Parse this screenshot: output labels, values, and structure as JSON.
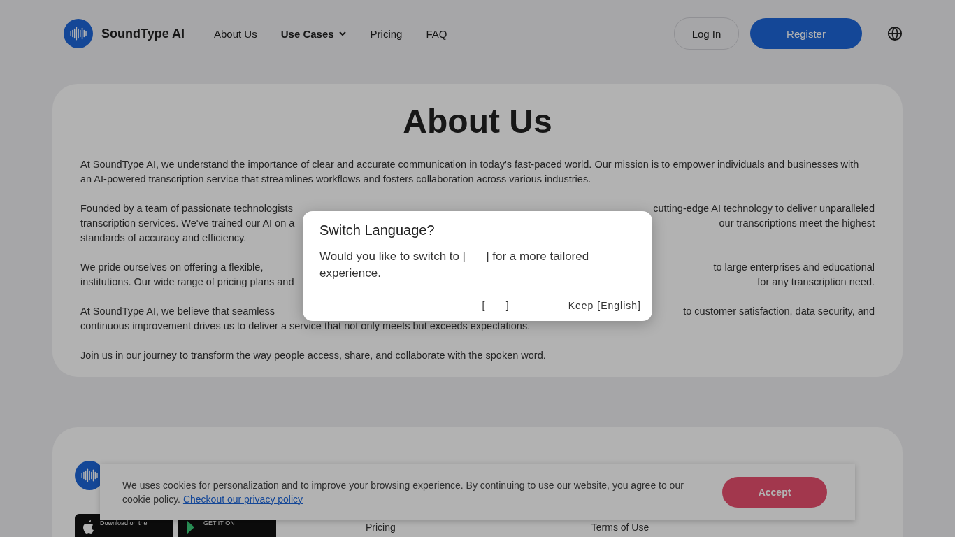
{
  "header": {
    "brand": "SoundType AI",
    "nav": [
      {
        "label": "About Us",
        "dropdown": false
      },
      {
        "label": "Use Cases",
        "dropdown": true
      },
      {
        "label": "Pricing",
        "dropdown": false
      },
      {
        "label": "FAQ",
        "dropdown": false
      }
    ],
    "login": "Log In",
    "register": "Register"
  },
  "about": {
    "title": "About Us",
    "paragraphs": [
      {
        "lines": [
          [
            "At SoundType AI, we understand the importance of clear and accurate communication in today's fast-paced world. Our mission is to empower individuals and businesses with"
          ],
          [
            "an AI-powered transcription service that streamlines workflows and fosters collaboration across various industries."
          ]
        ]
      },
      {
        "lines": [
          [
            "Founded by a team of passionate technologists",
            "cutting-edge AI technology to deliver unparalleled"
          ],
          [
            "transcription services. We've trained our AI on a",
            "our transcriptions meet the highest"
          ],
          [
            "standards of accuracy and efficiency."
          ]
        ]
      },
      {
        "lines": [
          [
            "We pride ourselves on offering a flexible,",
            "to large enterprises and educational"
          ],
          [
            "institutions. Our wide range of pricing plans and",
            "for any transcription need."
          ]
        ]
      },
      {
        "lines": [
          [
            "At SoundType AI, we believe that seamless",
            "to customer satisfaction, data security, and"
          ],
          [
            "continuous improvement drives us to deliver a service that not only meets but exceeds expectations."
          ]
        ]
      },
      {
        "lines": [
          [
            "Join us in our journey to transform the way people access, share, and collaborate with the spoken word."
          ]
        ]
      }
    ]
  },
  "footer": {
    "badges": [
      "Download on the",
      "GET IT ON"
    ],
    "links": [
      "Pricing",
      "Terms of Use"
    ]
  },
  "cookie": {
    "text": "We uses cookies for personalization and to improve your browsing experience. By continuing to use our website, you agree to our cookie policy.",
    "link": "Checkout our privacy policy",
    "accept": "Accept"
  },
  "dialog": {
    "title": "Switch Language?",
    "message": "Would you like to switch to [      ] for a more tailored experience.",
    "actions": [
      "[      ]",
      "Keep [English]"
    ]
  }
}
